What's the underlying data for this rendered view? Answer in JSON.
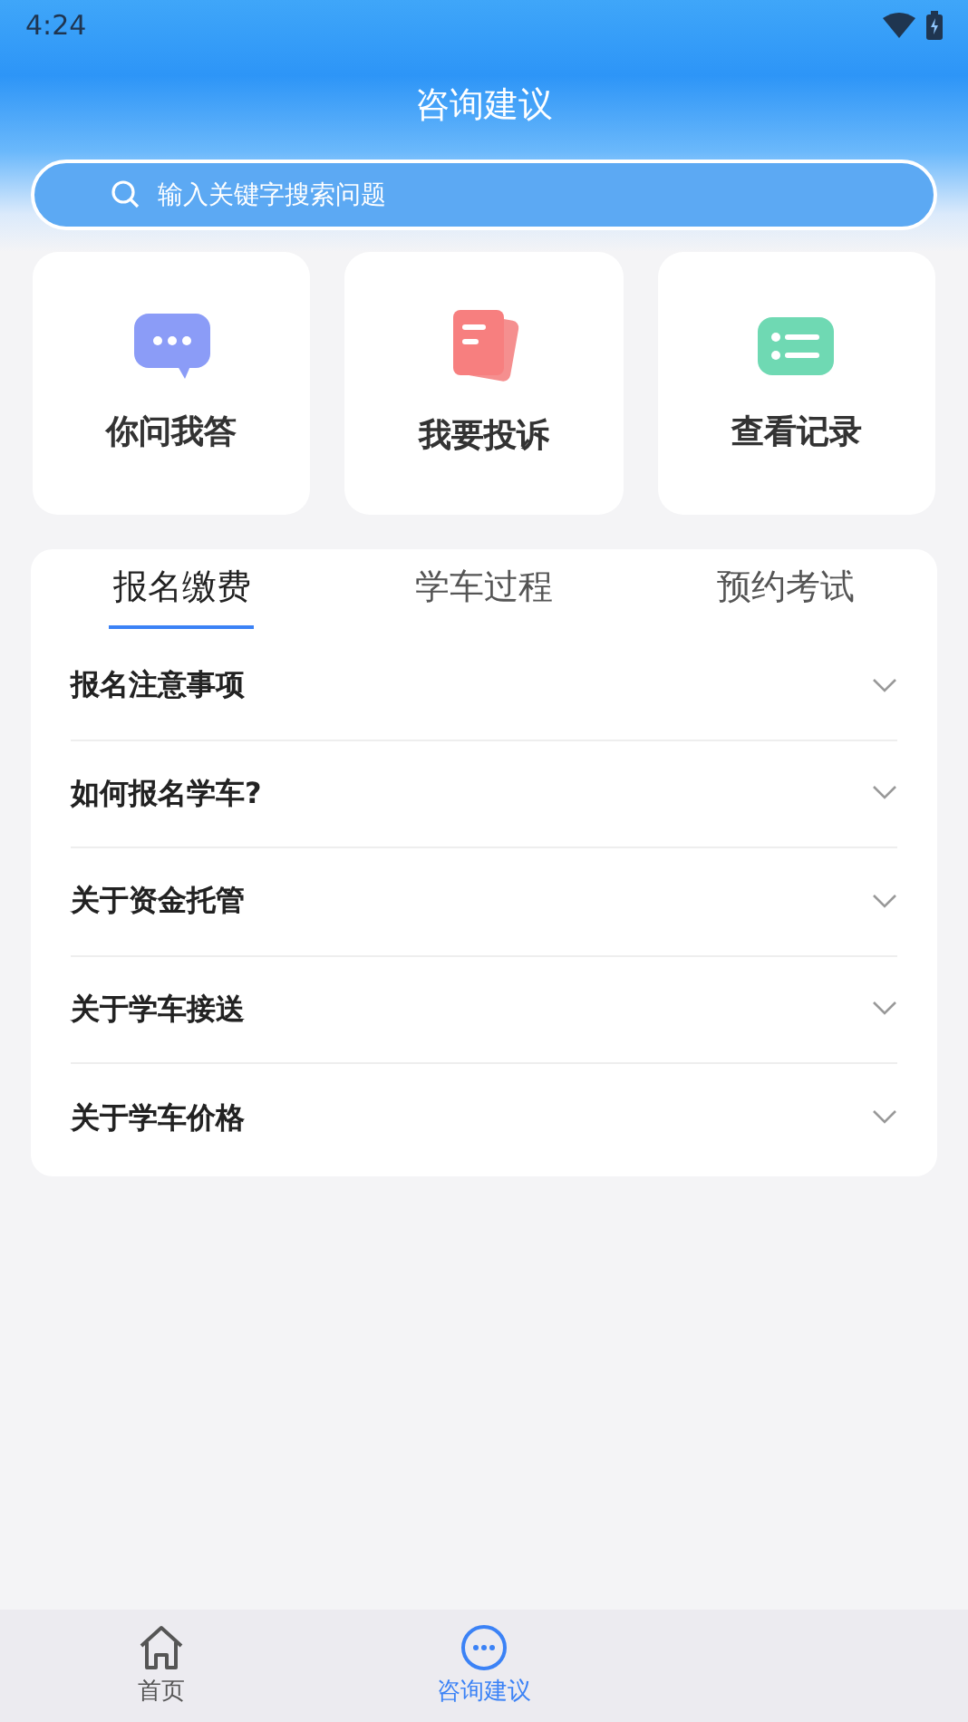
{
  "status_bar": {
    "time": "4:24"
  },
  "header": {
    "title": "咨询建议"
  },
  "search": {
    "placeholder": "输入关键字搜索问题"
  },
  "shortcuts": [
    {
      "label": "你问我答",
      "kind": "chat"
    },
    {
      "label": "我要投诉",
      "kind": "complaint"
    },
    {
      "label": "查看记录",
      "kind": "records"
    }
  ],
  "tabs": [
    {
      "label": "报名缴费",
      "selected": true
    },
    {
      "label": "学车过程",
      "selected": false
    },
    {
      "label": "预约考试",
      "selected": false
    }
  ],
  "faq": [
    {
      "question": "报名注意事项",
      "expanded": false
    },
    {
      "question": "如何报名学车?",
      "expanded": false
    },
    {
      "question": "关于资金托管",
      "expanded": false
    },
    {
      "question": "关于学车接送",
      "expanded": false
    },
    {
      "question": "关于学车价格",
      "expanded": false
    }
  ],
  "bottom_nav": [
    {
      "label": "首页",
      "kind": "home",
      "selected": false
    },
    {
      "label": "咨询建议",
      "kind": "consult",
      "selected": true
    }
  ]
}
